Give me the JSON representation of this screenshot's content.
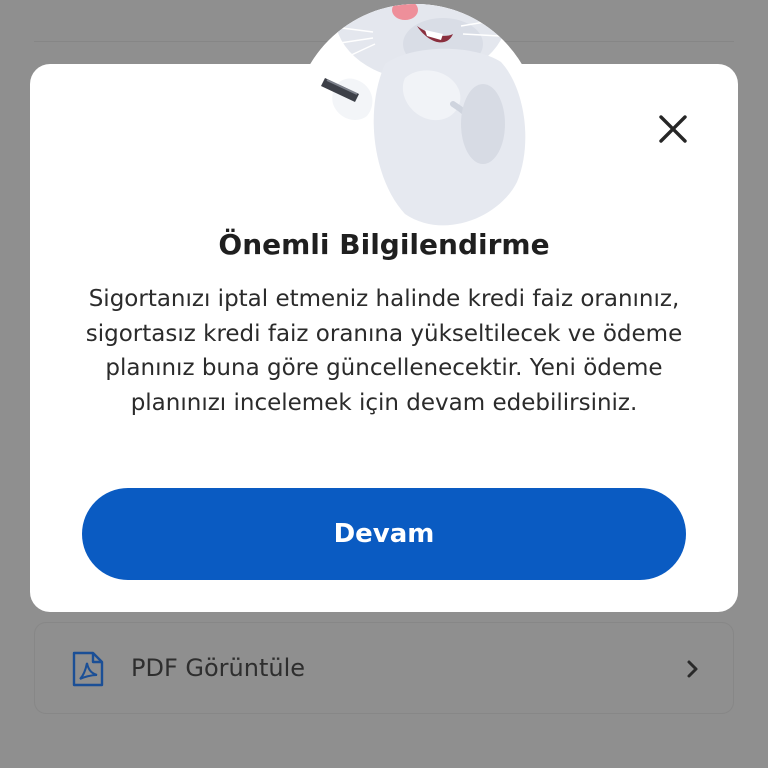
{
  "background": {
    "pdf_row": {
      "label": "PDF Görüntüle",
      "icon": "pdf-file-icon"
    }
  },
  "modal": {
    "title": "Önemli Bilgilendirme",
    "message": "Sigortanızı iptal etmeniz halinde kredi faiz oranınız, sigortasız kredi faiz oranına yükseltilecek ve ödeme planınız buna göre güncellenecektir. Yeni ödeme planınızı incelemek için devam edebilirsiniz.",
    "close_icon": "close-icon",
    "mascot": "rabbit-mascot-with-phone",
    "primary_button_label": "Devam"
  },
  "colors": {
    "overlay": "#8f8f8f",
    "primary": "#0a5bc2",
    "pdf_icon": "#1b4f96"
  }
}
